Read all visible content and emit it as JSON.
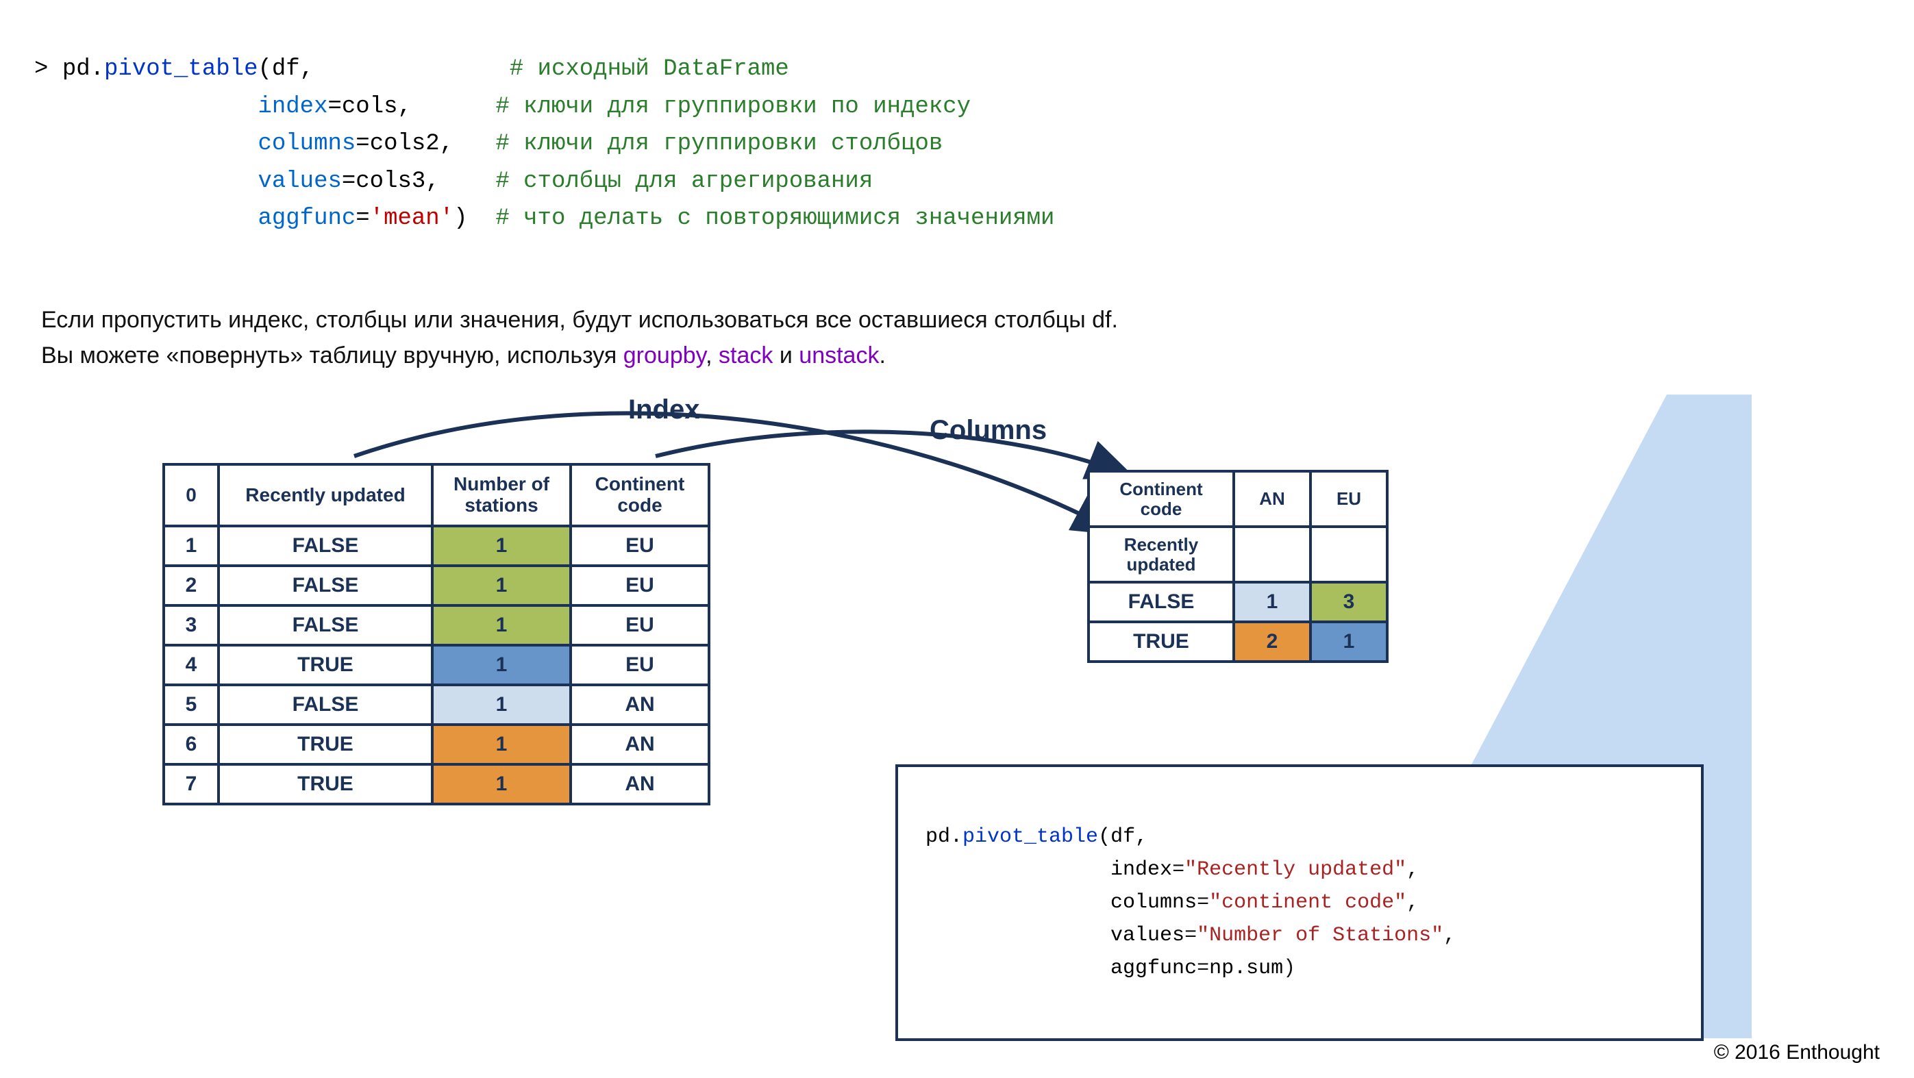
{
  "code_top": {
    "prompt": "> ",
    "module": "pd",
    "func": "pivot_table",
    "lines": [
      {
        "left": "pd.pivot_table(df,",
        "comment": "# исходный DataFrame"
      },
      {
        "left": "               index=cols,",
        "param": "index",
        "val": "cols",
        "comment": "# ключи для группировки по индексу"
      },
      {
        "left": "               columns=cols2,",
        "param": "columns",
        "val": "cols2",
        "comment": "# ключи для группировки столбцов"
      },
      {
        "left": "               values=cols3,",
        "param": "values",
        "val": "cols3",
        "comment": "# столбцы для агрегирования"
      },
      {
        "left": "               aggfunc='mean')",
        "param": "aggfunc",
        "val": "'mean'",
        "comment": "# что делать с повторяющимися значениями"
      }
    ]
  },
  "explanation": {
    "line1": "Если пропустить индекс, столбцы или значения, будут использоваться все оставшиеся столбцы df.",
    "line2_pre": "Вы можете «повернуть» таблицу вручную, используя ",
    "fn1": "groupby",
    "sep1": ", ",
    "fn2": "stack",
    "sep2": " и ",
    "fn3": "unstack",
    "tail": "."
  },
  "labels": {
    "index": "Index",
    "columns": "Columns"
  },
  "source_table": {
    "headers": {
      "idx": "0",
      "updated": "Recently updated",
      "stations": "Number of\nstations",
      "continent": "Continent\ncode"
    },
    "rows": [
      {
        "idx": "1",
        "updated": "FALSE",
        "stations": "1",
        "continent": "EU",
        "fill": "olive"
      },
      {
        "idx": "2",
        "updated": "FALSE",
        "stations": "1",
        "continent": "EU",
        "fill": "olive"
      },
      {
        "idx": "3",
        "updated": "FALSE",
        "stations": "1",
        "continent": "EU",
        "fill": "olive"
      },
      {
        "idx": "4",
        "updated": "TRUE",
        "stations": "1",
        "continent": "EU",
        "fill": "bluemed"
      },
      {
        "idx": "5",
        "updated": "FALSE",
        "stations": "1",
        "continent": "AN",
        "fill": "bluelt"
      },
      {
        "idx": "6",
        "updated": "TRUE",
        "stations": "1",
        "continent": "AN",
        "fill": "orange"
      },
      {
        "idx": "7",
        "updated": "TRUE",
        "stations": "1",
        "continent": "AN",
        "fill": "orange"
      }
    ]
  },
  "pivot_table": {
    "corner": "Continent\ncode",
    "col_labels": [
      "AN",
      "EU"
    ],
    "row_header_label": "Recently\nupdated",
    "rows": [
      {
        "label": "FALSE",
        "cells": [
          {
            "v": "1",
            "fill": "bluelt"
          },
          {
            "v": "3",
            "fill": "olive"
          }
        ]
      },
      {
        "label": "TRUE",
        "cells": [
          {
            "v": "2",
            "fill": "orange"
          },
          {
            "v": "1",
            "fill": "bluemed"
          }
        ]
      }
    ]
  },
  "code_panel": {
    "l1_pre": "pd.",
    "l1_func": "pivot_table",
    "l1_post": "(df,",
    "l2_param": "index",
    "l2_val": "\"Recently updated\"",
    "l3_param": "columns",
    "l3_val": "\"continent code\"",
    "l4_param": "values",
    "l4_val": "\"Number of Stations\"",
    "l5_param": "aggfunc",
    "l5_val": "np.sum"
  },
  "copyright": "© 2016 Enthought"
}
